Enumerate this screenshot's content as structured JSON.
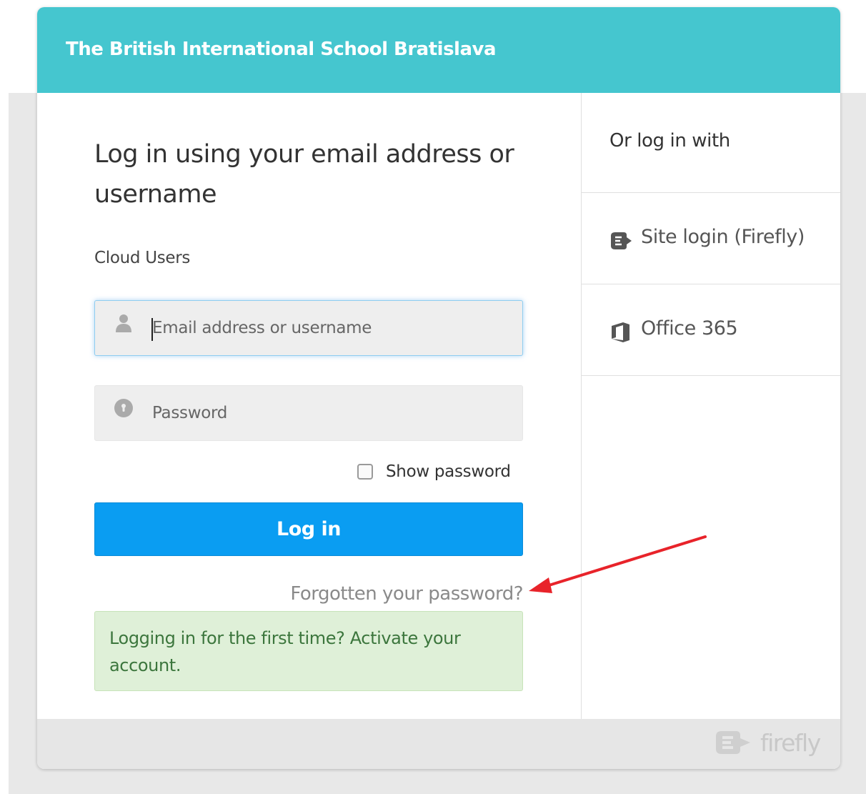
{
  "header": {
    "school_name": "The British International School Bratislava"
  },
  "login_form": {
    "heading": "Log in using your email address or username",
    "section_label": "Cloud Users",
    "email_placeholder": "Email address or username",
    "password_placeholder": "Password",
    "show_password_label": "Show password",
    "show_password_checked": false,
    "login_button": "Log in",
    "forgot_link": "Forgotten your password?",
    "first_time_notice": "Logging in for the first time? Activate your account."
  },
  "alt_login": {
    "title": "Or log in with",
    "providers": [
      {
        "label": "Site login (Firefly)",
        "icon": "firefly-icon"
      },
      {
        "label": "Office 365",
        "icon": "office365-icon"
      }
    ]
  },
  "footer": {
    "logo_text": "firefly"
  },
  "colors": {
    "header": "#45c6cf",
    "primary_button": "#0a9df2",
    "notice_bg": "#dff0d8",
    "notice_text": "#3c763d",
    "annotation_arrow": "#e8232a"
  }
}
